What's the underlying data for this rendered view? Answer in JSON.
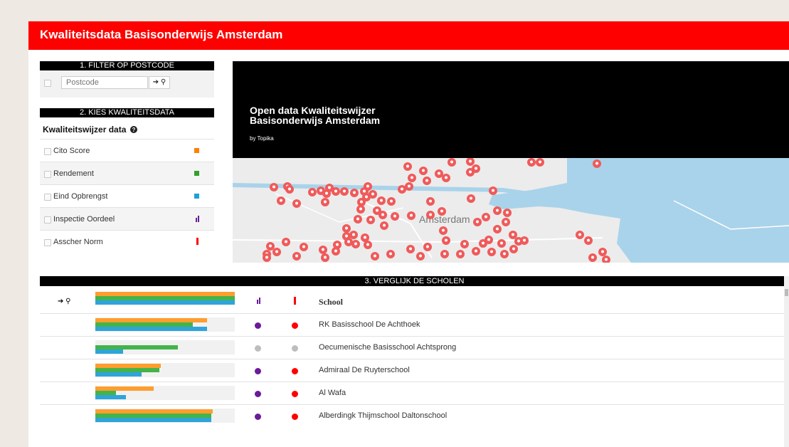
{
  "header": {
    "title": "Kwaliteitsdata Basisonderwijs Amsterdam"
  },
  "filter": {
    "section_label": "1. FILTER OP POSTCODE",
    "postcode_placeholder": "Postcode",
    "go_label": "➔ ⚲"
  },
  "quality": {
    "section_label": "2. KIES KWALITEITSDATA",
    "title": "Kwaliteitswijzer data",
    "info_icon": "question-circle-icon",
    "items": [
      {
        "label": "Cito Score",
        "color": "#ff7f00",
        "icon": "square-icon"
      },
      {
        "label": "Rendement",
        "color": "#33a02c",
        "icon": "square-icon"
      },
      {
        "label": "Eind Opbrengst",
        "color": "#1f9fd8",
        "icon": "square-icon"
      },
      {
        "label": "Inspectie Oordeel",
        "color": "#6a1b9a",
        "icon": "bar-pair-icon"
      },
      {
        "label": "Asscher Norm",
        "color": "#ff0000",
        "icon": "vertical-bar-icon"
      }
    ]
  },
  "hero": {
    "title_line1": "Open data Kwaliteitswijzer",
    "title_line2": "Basisonderwijs Amsterdam",
    "byline": "by Topika"
  },
  "map": {
    "city_label": "Amsterdam",
    "pin_color": "#f05a5a"
  },
  "compare": {
    "section_label": "3. VERGLIJK DE SCHOLEN",
    "header": {
      "nav_icon": "➔ ⚲",
      "school_col": "School"
    },
    "schools": [
      {
        "name": "RK Basisschool De Achthoek",
        "cito": 0.8,
        "rendement": 0.7,
        "eind": 0.8,
        "inspectie": "#6a1b9a",
        "asscher": "#ff0000"
      },
      {
        "name": "Oecumenische Basisschool Achtsprong",
        "cito": 0,
        "rendement": 0.59,
        "eind": 0.2,
        "inspectie": "#bdbdbd",
        "asscher": "#bdbdbd"
      },
      {
        "name": "Admiraal De Ruyterschool",
        "cito": 0.47,
        "rendement": 0.46,
        "eind": 0.33,
        "inspectie": "#6a1b9a",
        "asscher": "#ff0000"
      },
      {
        "name": "Al Wafa",
        "cito": 0.42,
        "rendement": 0.15,
        "eind": 0.22,
        "inspectie": "#6a1b9a",
        "asscher": "#ff0000"
      },
      {
        "name": "Alberdingk Thijmschool Daltonschool",
        "cito": 0.84,
        "rendement": 0.83,
        "eind": 0.83,
        "inspectie": "#6a1b9a",
        "asscher": "#ff0000"
      }
    ]
  }
}
